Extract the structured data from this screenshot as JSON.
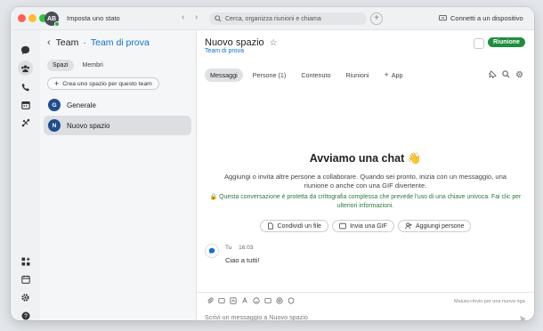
{
  "titlebar": {
    "avatar_initials": "AB",
    "status_label": "Imposta uno stato",
    "search_placeholder": "Cerca, organizza riunioni e chiama",
    "connect_label": "Connetti a un dispositivo"
  },
  "rail": {
    "items": [
      "messaging-icon",
      "teams-icon",
      "calls-icon",
      "calendar-icon",
      "activity-icon",
      "apps-icon",
      "schedule-icon",
      "settings-icon",
      "help-icon"
    ]
  },
  "panel": {
    "team_label": "Team",
    "separator": "·",
    "team_name": "Team di prova",
    "tabs": [
      "Spazi",
      "Membri"
    ],
    "create_label": "Crea uno spazio per questo team",
    "spaces": [
      {
        "initial": "G",
        "name": "Generale"
      },
      {
        "initial": "N",
        "name": "Nuovo spazio"
      }
    ]
  },
  "main": {
    "title": "Nuovo spazio",
    "subtitle": "Team di prova",
    "meeting_label": "Riunione",
    "tabs": [
      "Messaggi",
      "Persone (1)",
      "Contenuto",
      "Riunioni",
      "App"
    ],
    "hero_title": "Avviamo una chat 👋",
    "hero_text": "Aggiungi o invita altre persone a collaborare. Quando sei pronto, inizia con un messaggio, una riunione o anche con una GIF divertente.",
    "encryption_text": "Questa conversazione è protetta da crittografia complessa che prevede l'uso di una chiave univoca. Fai clic per ulteriori informazioni.",
    "actions": [
      "Condividi un file",
      "Invia una GIF",
      "Aggiungi persone"
    ],
    "message": {
      "author": "Tu",
      "time": "16:03",
      "text": "Ciao a tutti!"
    },
    "composer_hint": "Maiusc+Invio per una nuova riga",
    "composer_placeholder": "Scrivi un messaggio a Nuovo spazio"
  },
  "colors": {
    "accent_blue": "#1170cf",
    "meeting_green": "#1e8e3e",
    "encryption_green": "#2b7a3d",
    "space_avatar": "#1e4e8c"
  }
}
